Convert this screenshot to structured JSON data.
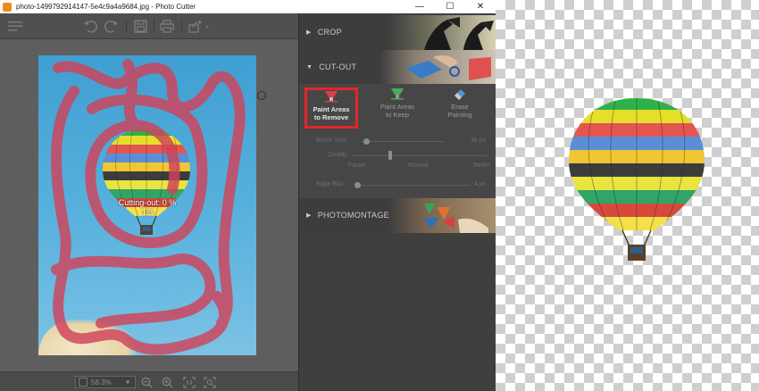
{
  "window": {
    "title": "photo-1499792914147-5e4c9a4a9684.jpg - Photo Cutter",
    "minimize_glyph": "—",
    "maximize_glyph": "☐",
    "close_glyph": "✕"
  },
  "toolbar": {
    "icons": [
      "menu-icon",
      "undo-icon",
      "redo-icon",
      "save-icon",
      "print-icon",
      "share-icon"
    ]
  },
  "canvas": {
    "progress_line1": "Cutting-out: 0 %",
    "progress_line2": "1/3",
    "paint_color": "#d0435a"
  },
  "status": {
    "zoom_value": "58.3%",
    "zoom_arrow": "▾",
    "icons": [
      "zoom-out-icon",
      "zoom-in-icon",
      "actual-size-icon",
      "fit-screen-icon"
    ]
  },
  "panel": {
    "crop_label": "CROP",
    "cutout_label": "CUT-OUT",
    "photomontage_label": "PHOTOMONTAGE",
    "tools": {
      "remove_line1": "Paint Areas",
      "remove_line2": "to Remove",
      "keep_line1": "Paint Areas",
      "keep_line2": "to Keep",
      "erase_line1": "Erase",
      "erase_line2": "Painting"
    },
    "brush_size_label": "Brush Size",
    "brush_size_value": "30 px",
    "brush_size_fraction": 0.05,
    "quality_label": "Quality",
    "quality_faster": "Faster",
    "quality_normal": "Normal",
    "quality_better": "Better",
    "quality_fraction": 0.28,
    "edge_blur_label": "Edge Blur",
    "edge_blur_value": "4 px",
    "edge_blur_fraction": 0.02,
    "highlight_color": "#e5252b"
  }
}
